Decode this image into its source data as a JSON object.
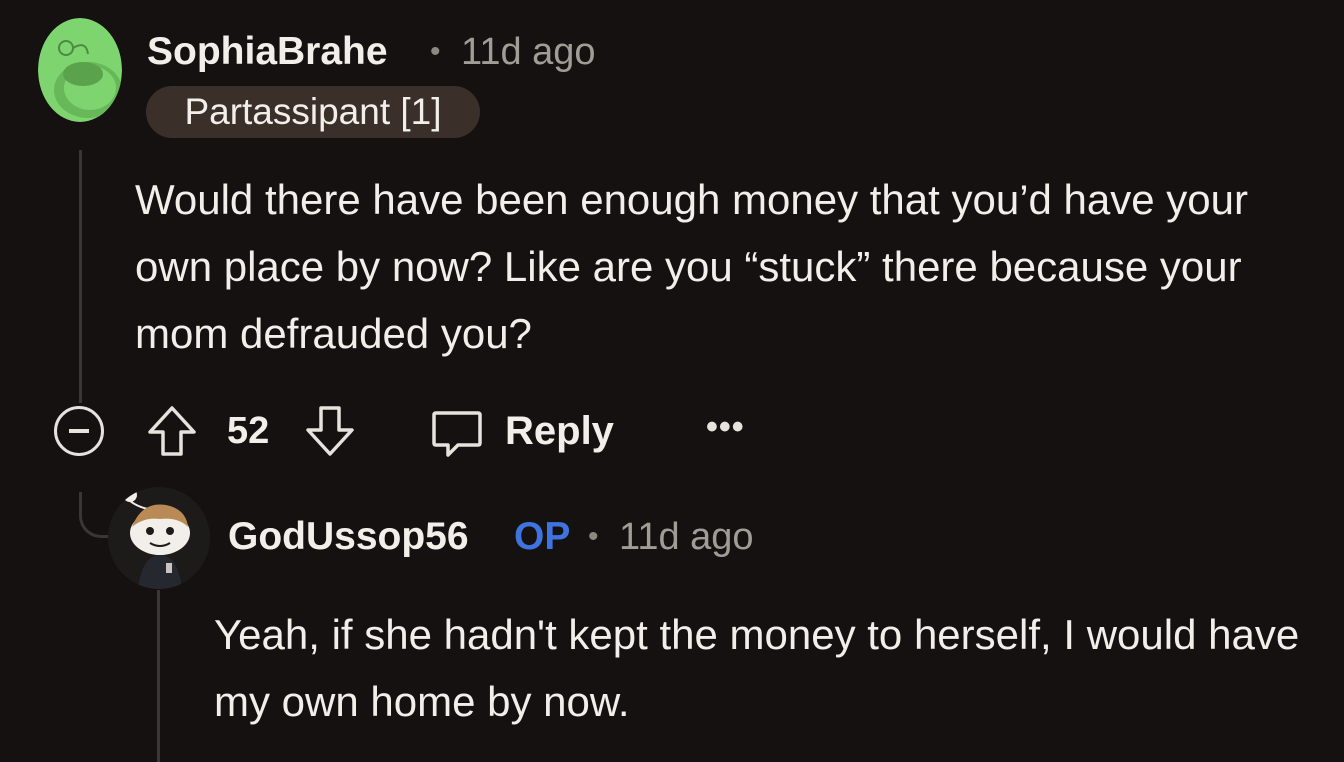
{
  "comment": {
    "username": "SophiaBrahe",
    "separator": "•",
    "time": "11d ago",
    "flair": "Partassipant [1]",
    "body": "Would there have been enough money that you’d have your own place by now? Like are you “stuck” there because your mom defrauded you?",
    "score": "52",
    "reply_label": "Reply",
    "more_label": "•••"
  },
  "reply": {
    "username": "GodUssop56",
    "op_badge": "OP",
    "separator": "•",
    "time": "11d ago",
    "body": "Yeah, if she hadn't kept the money to herself, I would have my own home by now."
  },
  "colors": {
    "background": "#141110",
    "op_badge": "#3f74e0",
    "flair_bg": "#3a2f29",
    "avatar_green": "#7ed56f"
  }
}
